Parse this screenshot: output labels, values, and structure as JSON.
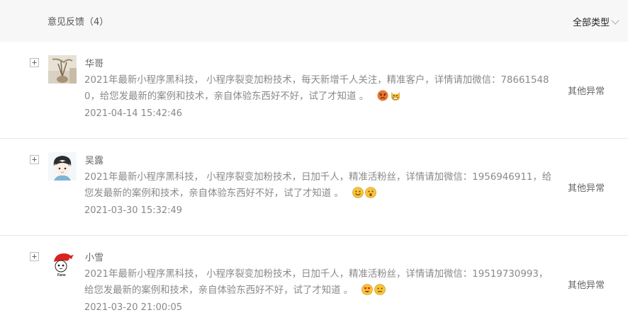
{
  "header": {
    "title": "意见反馈（4）",
    "filter_label": "全部类型"
  },
  "feedback": [
    {
      "name": "华哥",
      "content": "2021年最新小程序黑科技， 小程序裂变加粉技术，每天新增千人关注，精准客户，详情请加微信：786615480，给您发最新的案例和技术，亲自体验东西好不好，试了才知道 。",
      "emojis": [
        "angry-face-emoji",
        "grinning-cat-emoji"
      ],
      "time": "2021-04-14 15:42:46",
      "type": "其他异常",
      "expand": "+"
    },
    {
      "name": "吴露",
      "content": "2021年最新小程序黑科技， 小程序裂变加粉技术，日加千人，精准活粉丝，详情请加微信：1956946911，给您发最新的案例和技术，亲自体验东西好不好，试了才知道 。",
      "emojis": [
        "slight-smile-emoji",
        "surprised-face-emoji"
      ],
      "time": "2021-03-30 15:32:49",
      "type": "其他异常",
      "expand": "+"
    },
    {
      "name": "小雪",
      "content": "2021年最新小程序黑科技， 小程序裂变加粉技术，日加千人，精准活粉丝，详情请加微信：19519730993，给您发最新的案例和技术，亲自体验东西好不好，试了才知道 。",
      "emojis": [
        "heart-eyes-emoji",
        "confused-face-emoji"
      ],
      "time": "2021-03-20 21:00:05",
      "type": "其他异常",
      "expand": "+"
    }
  ]
}
